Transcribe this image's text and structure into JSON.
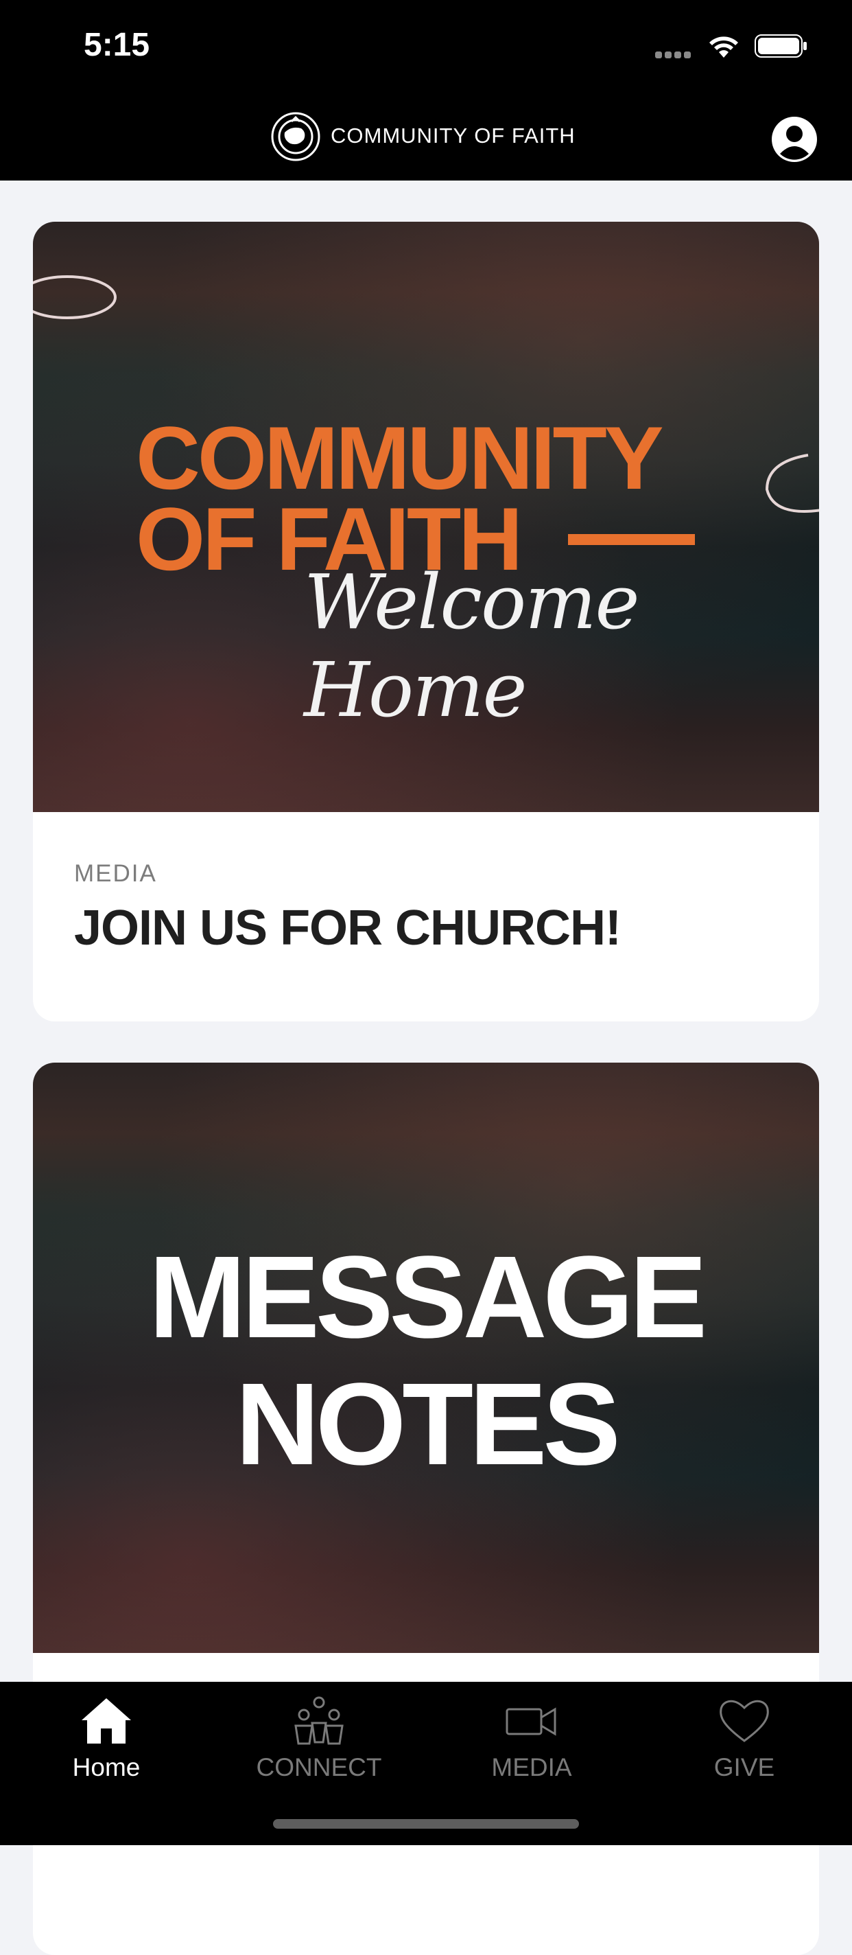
{
  "status_bar": {
    "time": "5:15"
  },
  "header": {
    "title": "COMMUNITY OF FAITH"
  },
  "cards": [
    {
      "image_text_line1": "COMMUNITY",
      "image_text_line2": "OF FAITH",
      "image_script": "Welcome Home",
      "category": "MEDIA",
      "title": "JOIN US FOR CHURCH!"
    },
    {
      "image_text_line1": "MESSAGE",
      "image_text_line2": "NOTES"
    }
  ],
  "tabs": [
    {
      "label": "Home",
      "icon": "home-icon",
      "active": true
    },
    {
      "label": "CONNECT",
      "icon": "people-icon",
      "active": false
    },
    {
      "label": "MEDIA",
      "icon": "video-camera-icon",
      "active": false
    },
    {
      "label": "GIVE",
      "icon": "heart-icon",
      "active": false
    }
  ],
  "colors": {
    "accent_orange": "#e8712e",
    "background": "#f2f3f7",
    "bar": "#000000"
  }
}
